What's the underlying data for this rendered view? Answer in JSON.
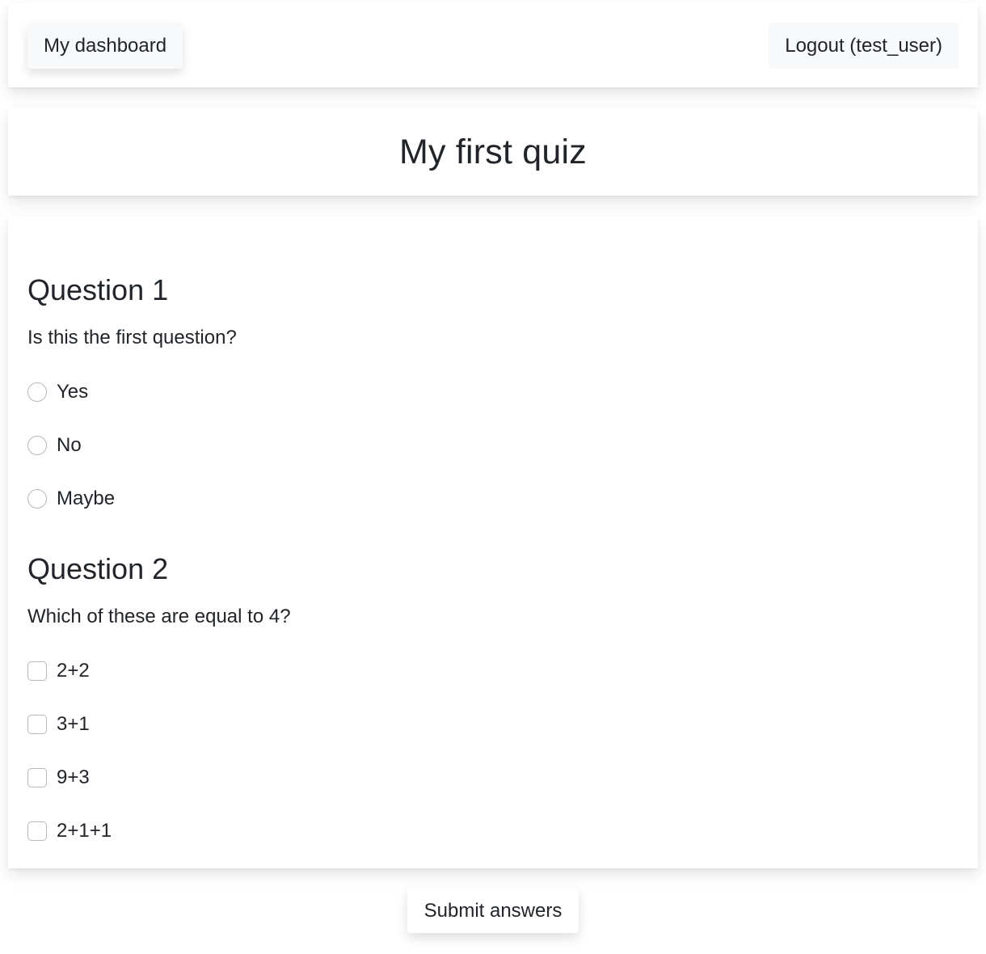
{
  "nav": {
    "dashboard_label": "My dashboard",
    "logout_label": "Logout (test_user)"
  },
  "quiz": {
    "title": "My first quiz",
    "questions": [
      {
        "heading": "Question 1",
        "text": "Is this the first question?",
        "type": "radio",
        "options": [
          "Yes",
          "No",
          "Maybe"
        ]
      },
      {
        "heading": "Question 2",
        "text": "Which of these are equal to 4?",
        "type": "checkbox",
        "options": [
          "2+2",
          "3+1",
          "9+3",
          "2+1+1"
        ]
      }
    ],
    "submit_label": "Submit answers"
  }
}
